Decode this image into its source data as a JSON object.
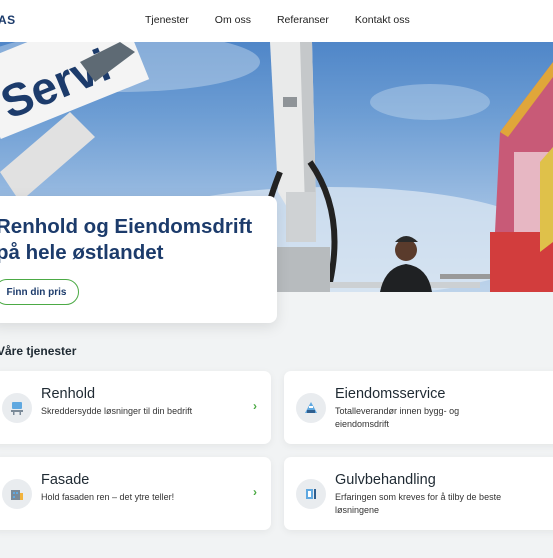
{
  "header": {
    "logo_text": "AS",
    "nav": [
      "Tjenester",
      "Om oss",
      "Referanser",
      "Kontakt oss"
    ]
  },
  "hero": {
    "truck_text": "Servi",
    "title": "Renhold og Eiendomsdrift på hele østlandet",
    "cta_label": "Finn din pris"
  },
  "services": {
    "section_title": "Våre tjenester",
    "items": [
      {
        "title": "Renhold",
        "desc": "Skreddersydde løsninger til din bedrift",
        "icon": "desk-icon",
        "chevron": "›"
      },
      {
        "title": "Eiendomsservice",
        "desc": "Totalleverandør innen bygg- og eiendomsdrift",
        "icon": "building-maintenance-icon"
      },
      {
        "title": "Fasade",
        "desc": "Hold fasaden ren – det ytre teller!",
        "icon": "facade-icon",
        "chevron": "›"
      },
      {
        "title": "Gulvbehandling",
        "desc": "Erfaringen som kreves for å tilby de beste løsningene",
        "icon": "floor-machine-icon"
      }
    ]
  },
  "colors": {
    "brand_blue": "#1c3b6b",
    "accent_green": "#4caa45",
    "background": "#f1f3f4"
  }
}
